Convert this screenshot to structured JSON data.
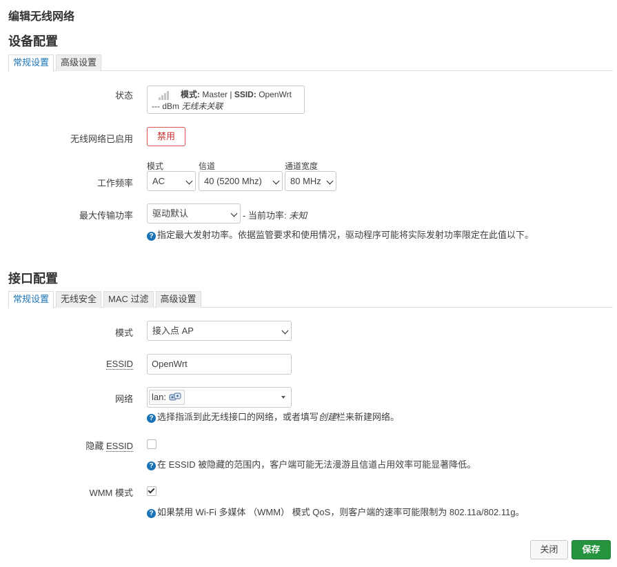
{
  "page_title": "编辑无线网络",
  "device": {
    "heading": "设备配置",
    "tabs": [
      "常规设置",
      "高级设置"
    ],
    "status": {
      "label": "状态",
      "mode_key": "模式:",
      "mode_value": "Master",
      "separator": "|",
      "ssid_key": "SSID:",
      "ssid_value": "OpenWrt",
      "dbm": "--- dBm",
      "assoc": "无线未关联"
    },
    "enabled": {
      "label": "无线网络已启用",
      "button": "禁用"
    },
    "frequency": {
      "label": "工作频率",
      "mode_label": "模式",
      "mode_value": "AC",
      "channel_label": "信道",
      "channel_value": "40 (5200 Mhz)",
      "width_label": "通道宽度",
      "width_value": "80 MHz"
    },
    "txpower": {
      "label": "最大传输功率",
      "value": "驱动默认",
      "current_prefix": "- 当前功率:",
      "current_value": "未知",
      "help": "指定最大发射功率。依据监管要求和使用情况，驱动程序可能将实际发射功率限定在此值以下。"
    }
  },
  "interface": {
    "heading": "接口配置",
    "tabs": [
      "常规设置",
      "无线安全",
      "MAC 过滤",
      "高级设置"
    ],
    "mode": {
      "label": "模式",
      "value": "接入点 AP"
    },
    "essid": {
      "label": "ESSID",
      "value": "OpenWrt"
    },
    "network": {
      "label": "网络",
      "value": "lan:",
      "help_prefix": "选择指派到此无线接口的网络，或者填写",
      "help_em": "创建",
      "help_suffix": "栏来新建网络。"
    },
    "hidden": {
      "label_prefix": "隐藏",
      "label_abbr": "ESSID",
      "checked": false,
      "help": "在 ESSID 被隐藏的范围内，客户端可能无法漫游且信道占用效率可能显著降低。"
    },
    "wmm": {
      "label": "WMM 模式",
      "checked": true,
      "help": "如果禁用 Wi-Fi 多媒体 （WMM） 模式 QoS，则客户端的速率可能限制为 802.11a/802.11g。"
    }
  },
  "buttons": {
    "close": "关闭",
    "save": "保存"
  },
  "colors": {
    "accent": "#1c74b8",
    "danger": "#d9534f",
    "save": "#26933f"
  },
  "icons": {
    "help": "question-circle-icon",
    "signal": "signal-bars-icon",
    "network": "network-interface-icon",
    "dropdown": "chevron-down-icon"
  }
}
